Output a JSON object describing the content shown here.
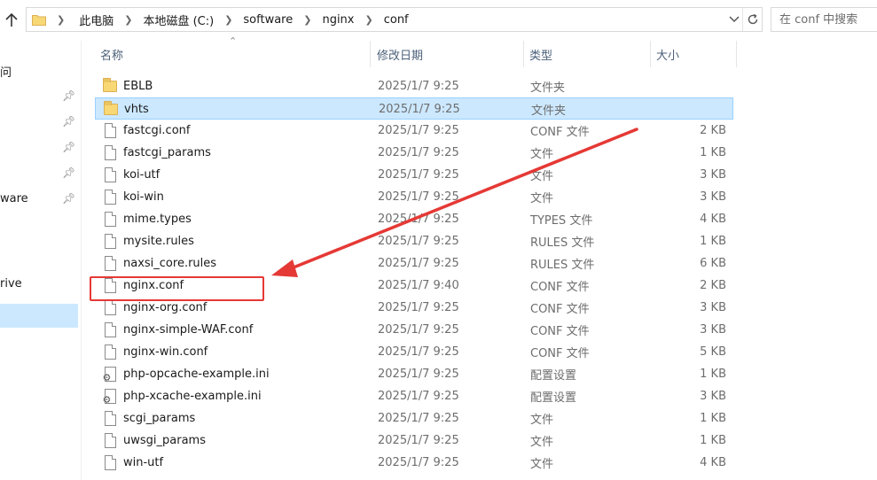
{
  "address": {
    "breadcrumbs": [
      "此电脑",
      "本地磁盘 (C:)",
      "software",
      "nginx",
      "conf"
    ]
  },
  "search": {
    "placeholder": "在 conf 中搜索"
  },
  "sidebar": {
    "items": [
      {
        "label": "问",
        "pinned": false
      },
      {
        "label": "",
        "pinned": true
      },
      {
        "label": "",
        "pinned": true
      },
      {
        "label": "",
        "pinned": true
      },
      {
        "label": "",
        "pinned": true
      },
      {
        "label": "ware",
        "pinned": true
      },
      {
        "label": "rive",
        "pinned": false
      }
    ]
  },
  "columns": {
    "name": "名称",
    "date": "修改日期",
    "type": "类型",
    "size": "大小"
  },
  "files": [
    {
      "name": "EBLB",
      "date": "2025/1/7 9:25",
      "type": "文件夹",
      "size": "",
      "icon": "folder-icon"
    },
    {
      "name": "vhts",
      "date": "2025/1/7 9:25",
      "type": "文件夹",
      "size": "",
      "icon": "folder-icon"
    },
    {
      "name": "fastcgi.conf",
      "date": "2025/1/7 9:25",
      "type": "CONF 文件",
      "size": "2 KB",
      "icon": "file-icon"
    },
    {
      "name": "fastcgi_params",
      "date": "2025/1/7 9:25",
      "type": "文件",
      "size": "1 KB",
      "icon": "file-icon"
    },
    {
      "name": "koi-utf",
      "date": "2025/1/7 9:25",
      "type": "文件",
      "size": "3 KB",
      "icon": "file-icon"
    },
    {
      "name": "koi-win",
      "date": "2025/1/7 9:25",
      "type": "文件",
      "size": "3 KB",
      "icon": "file-icon"
    },
    {
      "name": "mime.types",
      "date": "2025/1/7 9:25",
      "type": "TYPES 文件",
      "size": "4 KB",
      "icon": "file-icon"
    },
    {
      "name": "mysite.rules",
      "date": "2025/1/7 9:25",
      "type": "RULES 文件",
      "size": "1 KB",
      "icon": "file-icon"
    },
    {
      "name": "naxsi_core.rules",
      "date": "2025/1/7 9:25",
      "type": "RULES 文件",
      "size": "6 KB",
      "icon": "file-icon"
    },
    {
      "name": "nginx.conf",
      "date": "2025/1/7 9:40",
      "type": "CONF 文件",
      "size": "2 KB",
      "icon": "file-icon"
    },
    {
      "name": "nginx-org.conf",
      "date": "2025/1/7 9:25",
      "type": "CONF 文件",
      "size": "3 KB",
      "icon": "file-icon"
    },
    {
      "name": "nginx-simple-WAF.conf",
      "date": "2025/1/7 9:25",
      "type": "CONF 文件",
      "size": "3 KB",
      "icon": "file-icon"
    },
    {
      "name": "nginx-win.conf",
      "date": "2025/1/7 9:25",
      "type": "CONF 文件",
      "size": "5 KB",
      "icon": "file-icon"
    },
    {
      "name": "php-opcache-example.ini",
      "date": "2025/1/7 9:25",
      "type": "配置设置",
      "size": "1 KB",
      "icon": "ini-settings-icon"
    },
    {
      "name": "php-xcache-example.ini",
      "date": "2025/1/7 9:25",
      "type": "配置设置",
      "size": "3 KB",
      "icon": "ini-settings-icon"
    },
    {
      "name": "scgi_params",
      "date": "2025/1/7 9:25",
      "type": "文件",
      "size": "1 KB",
      "icon": "file-icon"
    },
    {
      "name": "uwsgi_params",
      "date": "2025/1/7 9:25",
      "type": "文件",
      "size": "1 KB",
      "icon": "file-icon"
    },
    {
      "name": "win-utf",
      "date": "2025/1/7 9:25",
      "type": "文件",
      "size": "4 KB",
      "icon": "file-icon"
    }
  ],
  "selected_row": "vhts",
  "highlighted_row": "nginx.conf",
  "colors": {
    "selection_bg": "#cce8ff",
    "selection_border": "#99d1ff",
    "annotation_red": "#e53935",
    "header_text": "#4c607a",
    "folder_yellow": "#f8d775"
  }
}
